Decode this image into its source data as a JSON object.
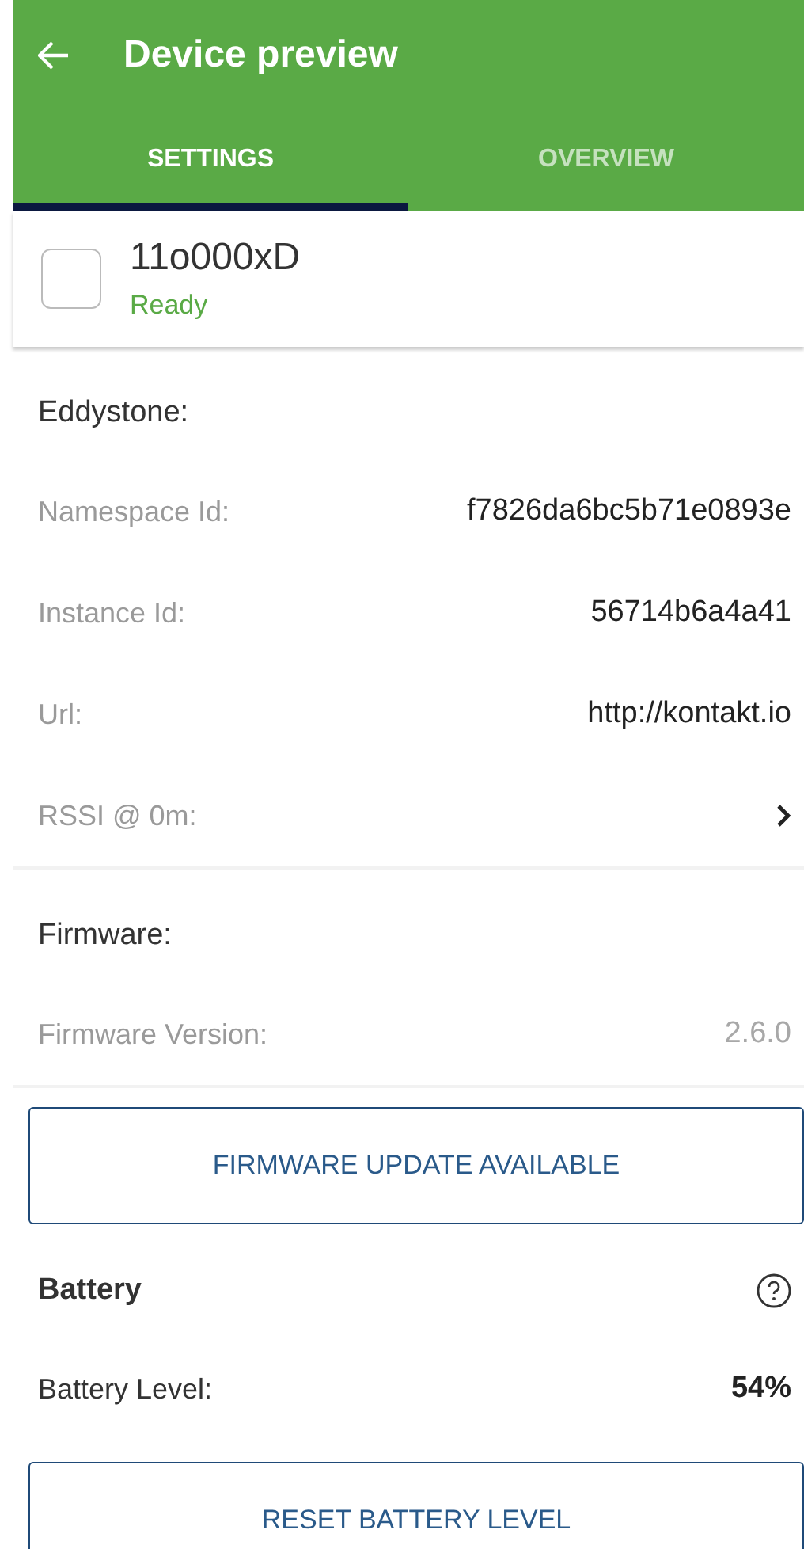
{
  "header": {
    "title": "Device preview"
  },
  "tabs": [
    {
      "label": "SETTINGS",
      "selected": true
    },
    {
      "label": "OVERVIEW",
      "selected": false
    }
  ],
  "device": {
    "name": "11o000xD",
    "status": "Ready"
  },
  "sections": [
    {
      "kind": "plain",
      "heading": "Eddystone:",
      "rows": [
        {
          "kind": "value",
          "label": "Namespace Id:",
          "value": "f7826da6bc5b71e0893e",
          "disabled": false
        },
        {
          "kind": "value",
          "label": "Instance Id:",
          "value": "56714b6a4a41",
          "disabled": false
        },
        {
          "kind": "value",
          "label": "Url:",
          "value": "http://kontakt.io",
          "disabled": false
        },
        {
          "kind": "chevron",
          "label": "RSSI @ 0m:"
        }
      ]
    },
    {
      "kind": "plain",
      "heading": "Firmware:",
      "rows": [
        {
          "kind": "value",
          "label": "Firmware Version:",
          "value": "2.6.0",
          "disabled": true
        }
      ],
      "button": "FIRMWARE UPDATE AVAILABLE"
    },
    {
      "kind": "help",
      "heading": "Battery",
      "rows": [
        {
          "kind": "strong",
          "label": "Battery Level:",
          "value": "54%"
        }
      ],
      "button": "RESET BATTERY LEVEL"
    }
  ]
}
